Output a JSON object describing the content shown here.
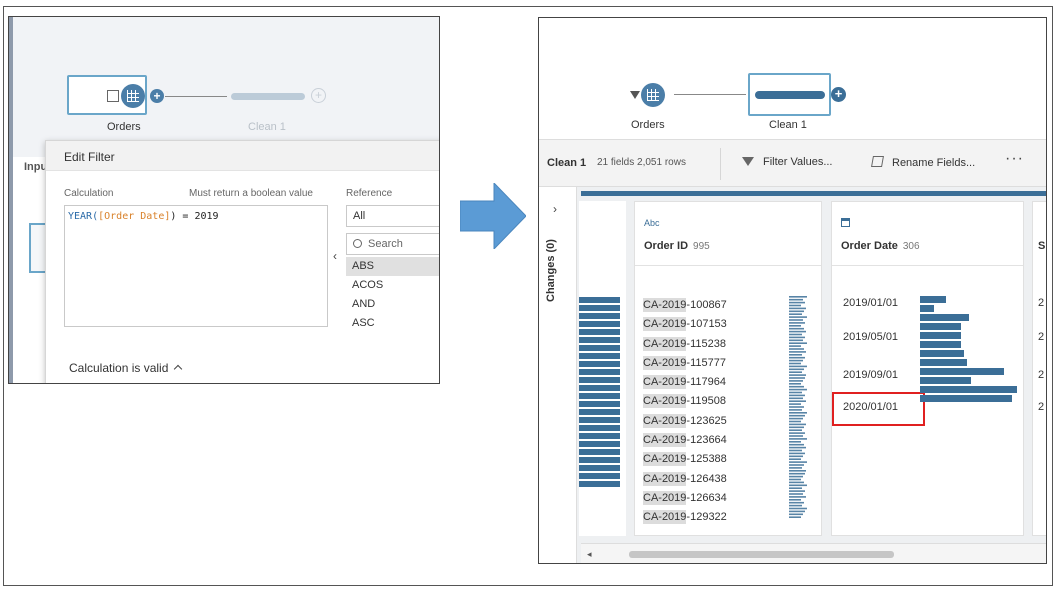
{
  "left": {
    "flow": {
      "node1_label": "Orders",
      "node2_label": "Clean 1"
    },
    "inpu_label": "Inpu",
    "edit_filter": {
      "title": "Edit Filter",
      "calculation_label": "Calculation",
      "boolean_hint": "Must return a boolean value",
      "reference_label": "Reference",
      "formula": {
        "fn": "YEAR(",
        "field": "[Order Date]",
        "rest": ") = 2019"
      },
      "reference_dropdown": "All",
      "search_placeholder": "Search",
      "functions": [
        "ABS",
        "ACOS",
        "AND",
        "ASC"
      ],
      "validity": "Calculation is valid"
    }
  },
  "right": {
    "flow": {
      "node1_label": "Orders",
      "node2_label": "Clean 1"
    },
    "toolbar": {
      "step_name": "Clean 1",
      "stats": "21 fields  2,051 rows",
      "filter_values": "Filter Values...",
      "rename_fields": "Rename Fields...",
      "more": "···"
    },
    "changes_label": "Changes (0)",
    "collapse_icon": "chevron-right-icon",
    "order_id": {
      "type_label": "Abc",
      "name": "Order ID",
      "count": "995",
      "values": [
        [
          "CA-",
          "2019",
          "-100867"
        ],
        [
          "CA-",
          "2019",
          "-107153"
        ],
        [
          "CA-",
          "2019",
          "-115238"
        ],
        [
          "CA-",
          "2019",
          "-115777"
        ],
        [
          "CA-",
          "2019",
          "-117964"
        ],
        [
          "CA-",
          "2019",
          "-119508"
        ],
        [
          "CA-",
          "2019",
          "-123625"
        ],
        [
          "CA-",
          "2019",
          "-123664"
        ],
        [
          "CA-",
          "2019",
          "-125388"
        ],
        [
          "CA-",
          "2019",
          "-126438"
        ],
        [
          "CA-",
          "2019",
          "-126634"
        ],
        [
          "CA-",
          "2019",
          "-129322"
        ]
      ]
    },
    "order_date": {
      "name": "Order Date",
      "count": "306",
      "labels": [
        "2019/01/01",
        "2019/05/01",
        "2019/09/01",
        "2020/01/01"
      ],
      "highlighted": "2020/01/01"
    },
    "next_col_initial": "S",
    "partial_values": [
      "2",
      "2",
      "2",
      "2"
    ],
    "colors": {
      "accent": "#3b6e97",
      "highlight": "#e02020",
      "arrow": "#5b9bd5"
    }
  }
}
